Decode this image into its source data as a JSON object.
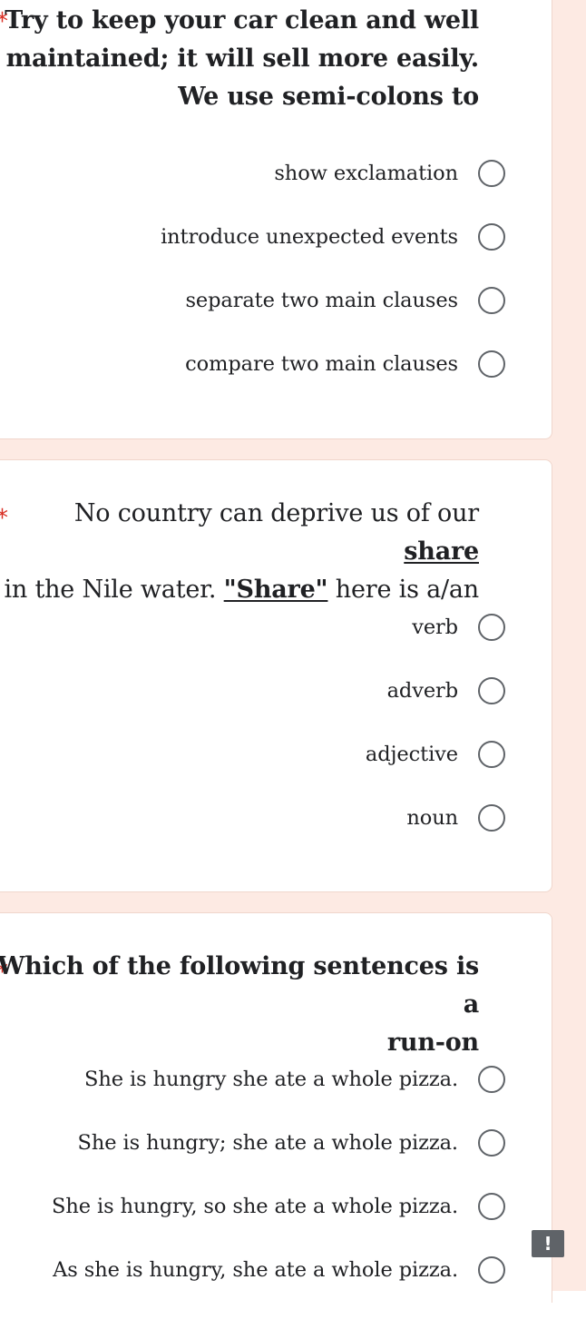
{
  "questions": [
    {
      "required_mark": "*",
      "lines": [
        "Try to keep your car clean and well",
        "maintained; it will sell more easily.",
        "We use semi-colons to"
      ],
      "options": [
        "show exclamation",
        "introduce unexpected events",
        "separate two main clauses",
        "compare two main clauses"
      ]
    },
    {
      "required_mark": "*",
      "line1_before": "No country can deprive us of our ",
      "line1_underlined": "share",
      "line2_before": "in the Nile water. ",
      "line2_underlined": "\"Share\"",
      "line2_after": " here is a/an",
      "options": [
        "verb",
        "adverb",
        "adjective",
        "noun"
      ]
    },
    {
      "required_mark": "*",
      "lines": [
        "Which of the following sentences is a",
        "run-on"
      ],
      "options": [
        "She is hungry she ate a whole pizza.",
        "She is hungry; she ate a whole pizza.",
        "She is hungry, so she ate a whole pizza.",
        "As she is hungry, she ate a whole pizza."
      ]
    }
  ],
  "report_icon": {
    "name": "report-problem-icon",
    "glyph": "!"
  },
  "colors": {
    "accent_background": "#fdeae3",
    "required": "#d93025",
    "radio_border": "#5f6368"
  }
}
